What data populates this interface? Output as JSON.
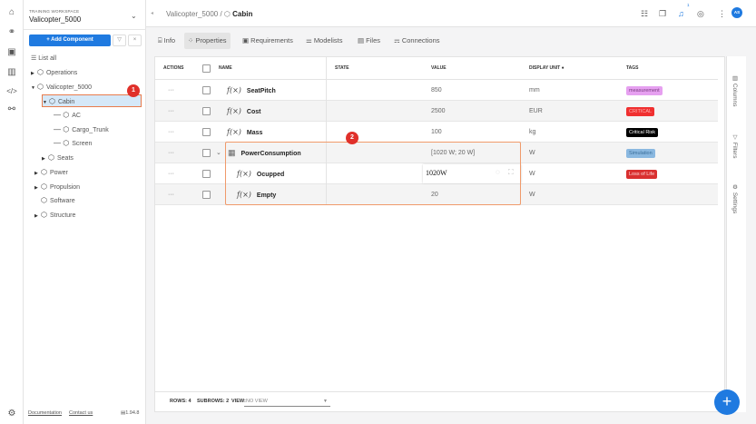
{
  "rail": {
    "icons": [
      "home-icon",
      "components-icon",
      "requirements-icon",
      "analytics-icon",
      "code-icon",
      "link-icon"
    ],
    "bottom_icon": "settings-icon"
  },
  "sidebar": {
    "workspace_label": "TRAINING WORKSPACE",
    "workspace_name": "Valicopter_5000",
    "add_component": "+ Add Component",
    "list_all": "List all",
    "tree": [
      {
        "label": "Operations"
      },
      {
        "label": "Valicopter_5000"
      },
      {
        "label": "Cabin"
      },
      {
        "label": "AC"
      },
      {
        "label": "Cargo_Trunk"
      },
      {
        "label": "Screen"
      },
      {
        "label": "Seats"
      },
      {
        "label": "Power"
      },
      {
        "label": "Propulsion"
      },
      {
        "label": "Software"
      },
      {
        "label": "Structure"
      }
    ],
    "documentation": "Documentation",
    "contact": "Contact us",
    "version": "1.94.8"
  },
  "annotations": {
    "one": "1",
    "two": "2"
  },
  "header": {
    "crumb_parent": "Valicopter_5000 /",
    "crumb_current": "Cabin",
    "notification_count": "1",
    "avatar": "AS"
  },
  "tabs": [
    "Info",
    "Properties",
    "Requirements",
    "Modelists",
    "Files",
    "Connections"
  ],
  "table": {
    "headers": {
      "actions": "ACTIONS",
      "name": "NAME",
      "state": "STATE",
      "value": "VALUE",
      "unit": "DISPLAY UNIT",
      "tags": "TAGS"
    },
    "rows": [
      {
        "actions": "···",
        "name": "SeatPitch",
        "value": "850",
        "unit": "mm",
        "tag": "measurement"
      },
      {
        "actions": "···",
        "name": "Cost",
        "value": "2500",
        "unit": "EUR",
        "tag": "CRITICAL"
      },
      {
        "actions": "···",
        "name": "Mass",
        "value": "100",
        "unit": "kg",
        "tag": "Critical Risk"
      },
      {
        "actions": "···",
        "name": "PowerConsumption",
        "value": "[1020 W; 20 W]",
        "unit": "W",
        "tag": "Simulation"
      },
      {
        "actions": "···",
        "name": "Ocupped",
        "value": "1020W",
        "unit": "W",
        "tag": "Loss of Life"
      },
      {
        "actions": "···",
        "name": "Empty",
        "value": "20",
        "unit": "W",
        "tag": ""
      }
    ],
    "footer": {
      "rows_label": "ROWS:",
      "rows": "4",
      "subrows_label": "SUBROWS:",
      "subrows": "2",
      "view_label": "VIEW:",
      "view": "NO VIEW"
    }
  },
  "right_panel": {
    "columns": "Columns",
    "filters": "Filters",
    "settings": "Settings"
  },
  "colors": {
    "accent": "#1f7ae0",
    "measurement": "#e6a0f0",
    "critical": "#f03030",
    "critical_risk": "#000000",
    "simulation": "#8ab8e0",
    "loss_of_life": "#d93030"
  }
}
